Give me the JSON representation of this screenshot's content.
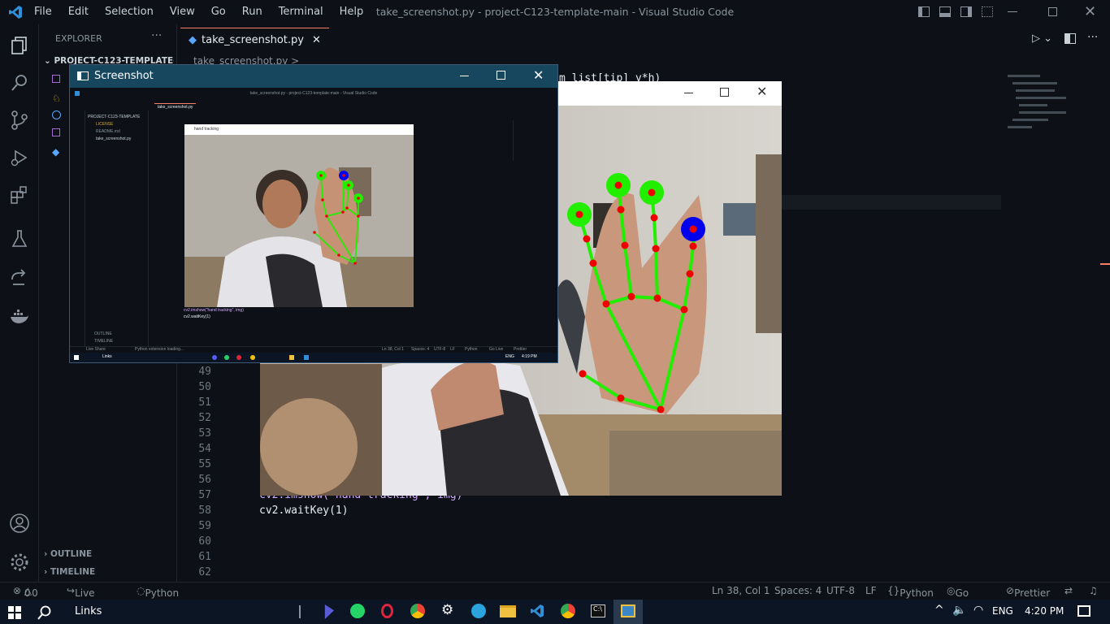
{
  "window": {
    "title": "take_screenshot.py - project-C123-template-main - Visual Studio Code",
    "menu": [
      "File",
      "Edit",
      "Selection",
      "View",
      "Go",
      "Run",
      "Terminal",
      "Help"
    ]
  },
  "sidebar": {
    "explorer_label": "EXPLORER",
    "project_label": "PROJECT-C123-TEMPLATE-...",
    "outline_label": "OUTLINE",
    "timeline_label": "TIMELINE"
  },
  "editor": {
    "tab_label": "take_screenshot.py",
    "breadcrumb": "take_screenshot.py >",
    "code_fragment_top": "m list[tip] y*h)",
    "line_numbers": [
      "49",
      "50",
      "51",
      "52",
      "53",
      "54",
      "55",
      "56",
      "57",
      "58",
      "59",
      "60",
      "61",
      "62"
    ],
    "code_line_57": "cv2.imshow(\"hand tracking\", img)",
    "code_line_58": "cv2.waitKey(1)"
  },
  "hand_window": {
    "title": ""
  },
  "screenshot_window": {
    "title": "Screenshot",
    "inner_title": "take_screenshot.py - project-C123-template-main - Visual Studio Code",
    "inner_tab": "take_screenshot.py",
    "inner_files": [
      "PROJECT-C123-TEMPLATE",
      "LICENSE",
      "README.md",
      "take_screenshot.py"
    ],
    "inner_hand_title": "hand tracking",
    "inner_code_1": "cv2.imshow(\"hand tracking\", img)",
    "inner_code_2": "cv2.waitKey(1)",
    "inner_outline": "OUTLINE",
    "inner_timeline": "TIMELINE",
    "inner_status": [
      "Live Share",
      "Python extension loading...",
      "Ln 38, Col 1",
      "Spaces: 4",
      "UTF-8",
      "LF",
      "Python",
      "Go Live",
      "Prettier"
    ],
    "inner_taskbar_search": "Links",
    "inner_lang": "ENG",
    "inner_time": "4:19 PM"
  },
  "statusbar": {
    "problems": "0",
    "warnings": "0",
    "live_share": "Live Share",
    "python_loading": "Python extension loading...",
    "position": "Ln 38, Col 1",
    "spaces": "Spaces: 4",
    "encoding": "UTF-8",
    "eol": "LF",
    "language": "Python",
    "go_live": "Go Live",
    "prettier": "Prettier"
  },
  "taskbar": {
    "search_label": "Links",
    "lang": "ENG",
    "time": "4:20 PM"
  },
  "colors": {
    "accent": "#f78166",
    "hand_lines": "#22ee00",
    "landmark": "#ee0000",
    "tip_blue": "#0000ee"
  }
}
